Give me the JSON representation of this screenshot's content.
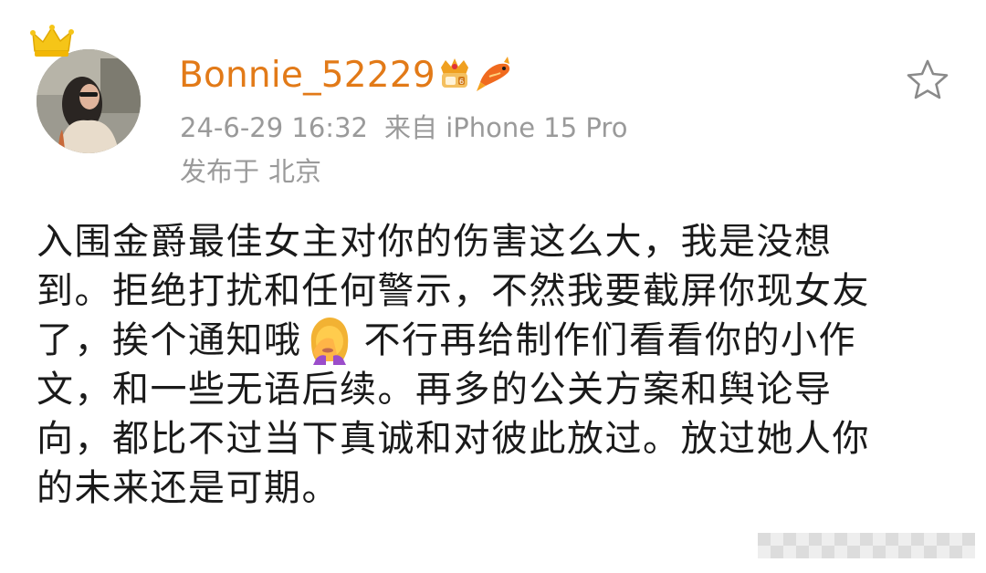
{
  "post": {
    "username": "Bonnie_52229",
    "timestamp": "24-6-29 16:32",
    "source": "来自 iPhone 15 Pro",
    "location_prefix": "发布于",
    "location": "北京",
    "icons": {
      "avatar_crown": "crown-icon",
      "vip_badge": "vip-crown-badge-icon",
      "fan_badge": "koi-fish-badge-icon",
      "favorite": "star-outline-icon",
      "inline_emoji": "woman-facepalming-emoji"
    },
    "body_lines": [
      "入围金爵最佳女主对你的伤害这么大，我是没想",
      "到。拒绝打扰和任何警示，不然我要截屏你现女友",
      "了，挨个通知哦",
      "文，和一些无语后续。再多的公关方案和舆论导",
      "向，都比不过当下真诚和对彼此放过。放过她人你",
      "的未来还是可期。"
    ],
    "line3_after_emoji": "不行再给制作们看看你的小作"
  },
  "colors": {
    "username": "#e27a18",
    "meta": "#9a9a9a",
    "body": "#1a1a1a",
    "crown": "#f5c518"
  }
}
